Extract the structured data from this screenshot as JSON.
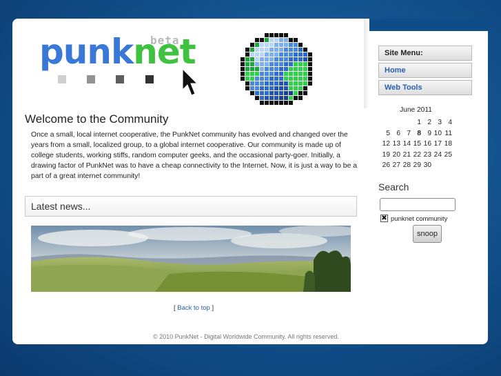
{
  "logo": {
    "part1": "punk",
    "part2": "net",
    "tag": "beta",
    "colors": {
      "punk": "#3a78d8",
      "net": "#3fc23f",
      "tag": "#b9b9b9"
    }
  },
  "header": {
    "cursor_icon": "arrow-cursor-icon",
    "globe_icon": "pixel-globe-icon"
  },
  "main": {
    "title": "Welcome to the Community",
    "intro": "Once a small, local internet cooperative, the PunkNet community has evolved and changed over the years from a small, localized group, to a global internet cooperative. Our community is made up of college students, working stiffs, random computer geeks, and the occasional party-goer. Initially, a drawing factor of PunkNet was to have a cheap connectivity to the Internet. Now, it is just a way to be a part of a great internet community!",
    "news_title": "Latest news...",
    "back_to_top_left": "[ ",
    "back_to_top_label": "Back to top",
    "back_to_top_right": " ]"
  },
  "footer": {
    "text": "© 2010 PunkNet - Digital Worldwide Community. All rights reserved."
  },
  "sidebar": {
    "menu_title": "Site Menu:",
    "items": [
      {
        "label": "Home"
      },
      {
        "label": "Web Tools"
      }
    ],
    "calendar": {
      "title": "June 2011",
      "today": "8",
      "weeks": [
        [
          "",
          "",
          "",
          "1",
          "2",
          "3",
          "4"
        ],
        [
          "5",
          "6",
          "7",
          "8",
          "9",
          "10",
          "11"
        ],
        [
          "12",
          "13",
          "14",
          "15",
          "16",
          "17",
          "18"
        ],
        [
          "19",
          "20",
          "21",
          "22",
          "23",
          "24",
          "25"
        ],
        [
          "26",
          "27",
          "28",
          "29",
          "30",
          "",
          ""
        ]
      ]
    },
    "search": {
      "title": "Search",
      "input_value": "",
      "checkbox_label": "punknet community",
      "checkbox_checked": true,
      "button_label": "snoop"
    }
  },
  "colors": {
    "background": "#13538f",
    "link": "#2a5fb0"
  }
}
